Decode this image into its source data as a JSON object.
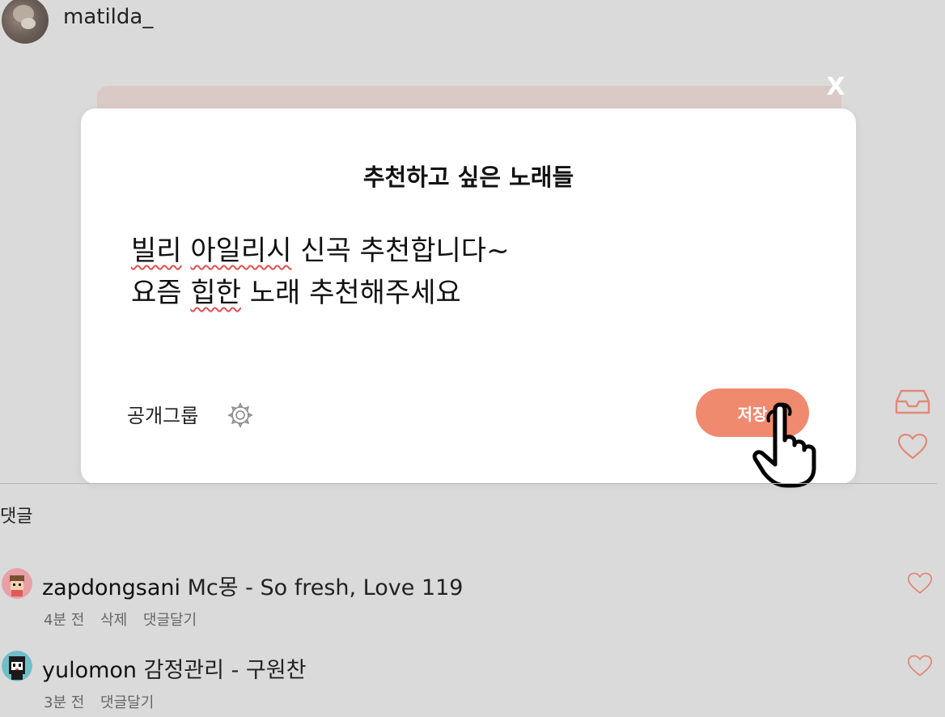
{
  "header": {
    "username": "matilda_"
  },
  "dialog": {
    "close_label": "X",
    "title": "추천하고 싶은 노래들",
    "lines": [
      {
        "underlined_1": "빌리",
        "plain_1": " ",
        "underlined_2": "아일리시",
        "plain_2": " 신곡 추천합니다~"
      },
      {
        "plain_a": "요즘 ",
        "underlined": "힙한",
        "plain_b": " 노래 추천해주세요"
      }
    ],
    "group_label": "공개그룹",
    "save_label": "저장"
  },
  "comments_section": {
    "title": "댓글",
    "items": [
      {
        "user": "zapdongsani",
        "text": " Mc몽 - So fresh, Love 119",
        "time": "4분 전",
        "actions": [
          "삭제",
          "댓글달기"
        ]
      },
      {
        "user": "yulomon",
        "text": " 감정관리 - 구원찬",
        "time": "3분 전",
        "actions": [
          "댓글달기"
        ]
      }
    ]
  },
  "colors": {
    "accent": "#f08a6e",
    "background": "#dadada",
    "heart": "#e08a78"
  }
}
